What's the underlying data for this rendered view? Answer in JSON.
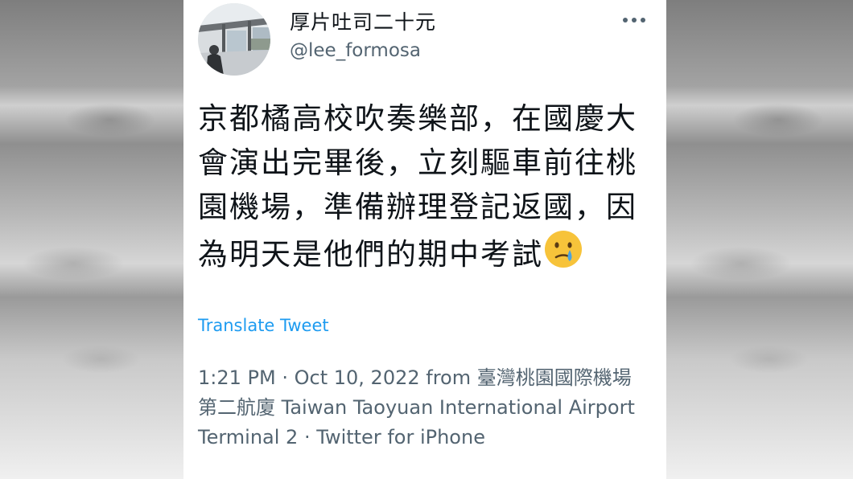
{
  "author": {
    "display_name": "厚片吐司二十元",
    "handle": "@lee_formosa",
    "avatar_icon": "profile-photo"
  },
  "more_icon": "more-horizontal-icon",
  "tweet": {
    "text": "京都橘高校吹奏樂部，在國慶大會演出完畢後，立刻驅車前往桃園機場，準備辦理登記返國，因為明天是他們的期中考試",
    "emoji": "crying-face-emoji"
  },
  "translate_label": "Translate Tweet",
  "meta": {
    "time": "1:21 PM",
    "date": "Oct 10, 2022",
    "from_word": "from",
    "location": "臺灣桃園國際機場第二航廈 Taiwan Taoyuan International Airport Terminal 2",
    "client": "Twitter for iPhone",
    "separator": "·"
  },
  "colors": {
    "text": "#0f1419",
    "secondary": "#536471",
    "link": "#1d9bf0",
    "emoji_face": "#f7c33a"
  }
}
